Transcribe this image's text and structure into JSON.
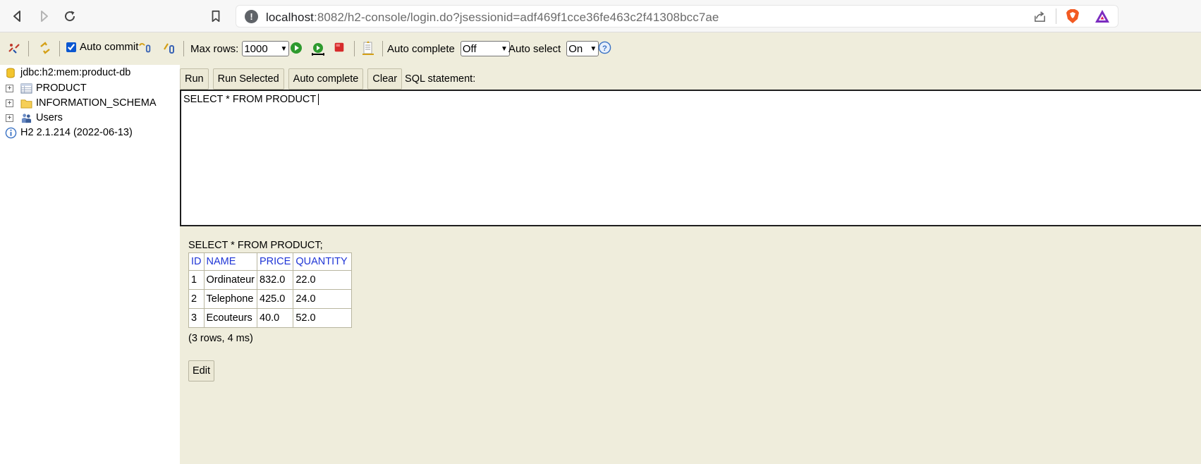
{
  "browser": {
    "url_host": "localhost",
    "url_path": ":8082/h2-console/login.do?jsessionid=adf469f1cce36fe463c2f41308bcc7ae"
  },
  "toolbar": {
    "auto_commit_label": "Auto commit",
    "auto_commit_checked": true,
    "max_rows_label": "Max rows:",
    "max_rows_value": "1000",
    "auto_complete_label": "Auto complete",
    "auto_complete_value": "Off",
    "auto_select_label": "Auto select",
    "auto_select_value": "On"
  },
  "tree": {
    "connection": "jdbc:h2:mem:product-db",
    "nodes": [
      "PRODUCT",
      "INFORMATION_SCHEMA",
      "Users"
    ],
    "version": "H2 2.1.214 (2022-06-13)"
  },
  "editor": {
    "buttons": [
      "Run",
      "Run Selected",
      "Auto complete",
      "Clear"
    ],
    "sql_label": "SQL statement:",
    "sql_text": "SELECT * FROM PRODUCT"
  },
  "result": {
    "query": "SELECT * FROM PRODUCT;",
    "columns": [
      "ID",
      "NAME",
      "PRICE",
      "QUANTITY"
    ],
    "rows": [
      [
        "1",
        "Ordinateur",
        "832.0",
        "22.0"
      ],
      [
        "2",
        "Telephone",
        "425.0",
        "24.0"
      ],
      [
        "3",
        "Ecouteurs",
        "40.0",
        "52.0"
      ]
    ],
    "info": "(3 rows, 4 ms)",
    "edit_label": "Edit"
  },
  "colors": {
    "panel_bg": "#efeddc",
    "header_link": "#1f35d6"
  }
}
